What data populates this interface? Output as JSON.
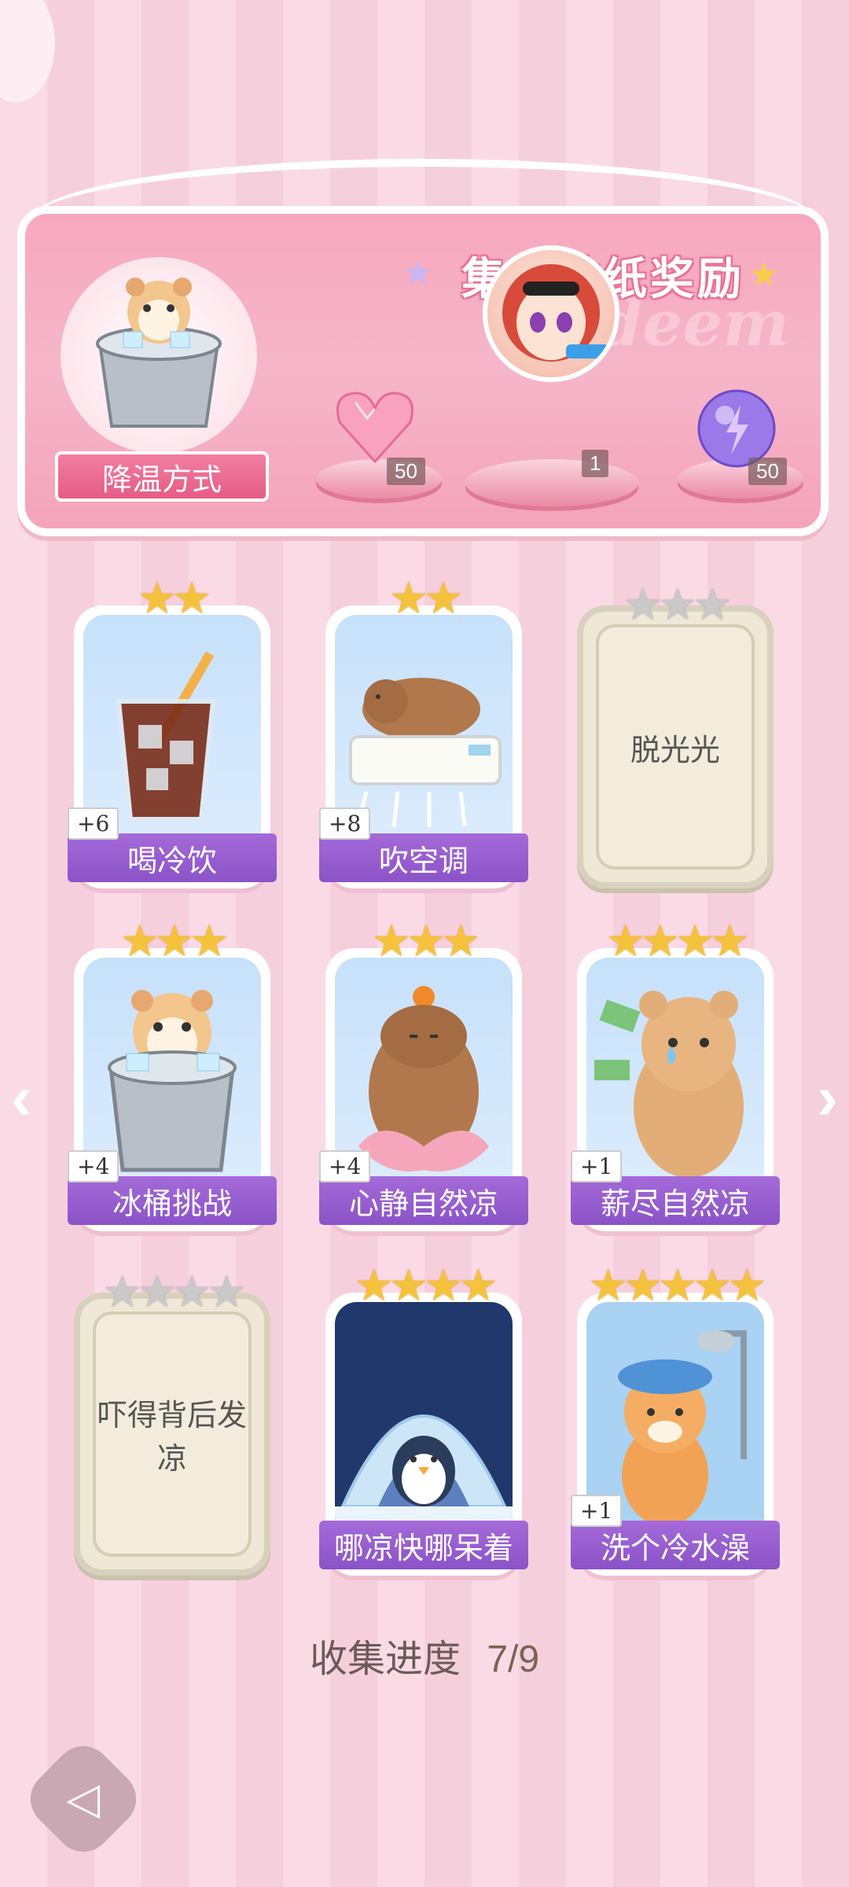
{
  "banner": {
    "title": "集齐贴纸奖励",
    "watermark": "Redeem",
    "method_label": "降温方式",
    "rewards": [
      {
        "icon": "heart-gem-icon",
        "count": "50"
      },
      {
        "icon": "character-avatar",
        "count": "1"
      },
      {
        "icon": "lightning-orb-icon",
        "count": "50"
      }
    ]
  },
  "cards": [
    {
      "name": "喝冷饮",
      "bonus": "+6",
      "stars": 2,
      "max_stars": 2,
      "collected": true,
      "icon": "iced-cola-icon"
    },
    {
      "name": "吹空调",
      "bonus": "+8",
      "stars": 2,
      "max_stars": 2,
      "collected": true,
      "icon": "capybara-aircon-icon"
    },
    {
      "name": "脱光光",
      "bonus": "",
      "stars": 0,
      "max_stars": 3,
      "collected": false,
      "icon": ""
    },
    {
      "name": "冰桶挑战",
      "bonus": "+4",
      "stars": 3,
      "max_stars": 3,
      "collected": true,
      "icon": "hamster-ice-bucket-icon"
    },
    {
      "name": "心静自然凉",
      "bonus": "+4",
      "stars": 3,
      "max_stars": 3,
      "collected": true,
      "icon": "meditating-capybara-icon"
    },
    {
      "name": "薪尽自然凉",
      "bonus": "+1",
      "stars": 4,
      "max_stars": 4,
      "collected": true,
      "icon": "crying-bear-money-icon"
    },
    {
      "name": "吓得背后发凉",
      "bonus": "",
      "stars": 0,
      "max_stars": 4,
      "collected": false,
      "icon": ""
    },
    {
      "name": "哪凉快哪呆着",
      "bonus": "",
      "stars": 4,
      "max_stars": 4,
      "collected": true,
      "icon": "penguin-igloo-icon"
    },
    {
      "name": "洗个冷水澡",
      "bonus": "+1",
      "stars": 5,
      "max_stars": 5,
      "collected": true,
      "icon": "cat-shower-icon"
    }
  ],
  "progress": {
    "label": "收集进度",
    "value": "7/9"
  },
  "colors": {
    "accent_purple": "#9a5fd2",
    "banner_pink": "#f7a8be",
    "star_gold": "#f5c23c"
  }
}
